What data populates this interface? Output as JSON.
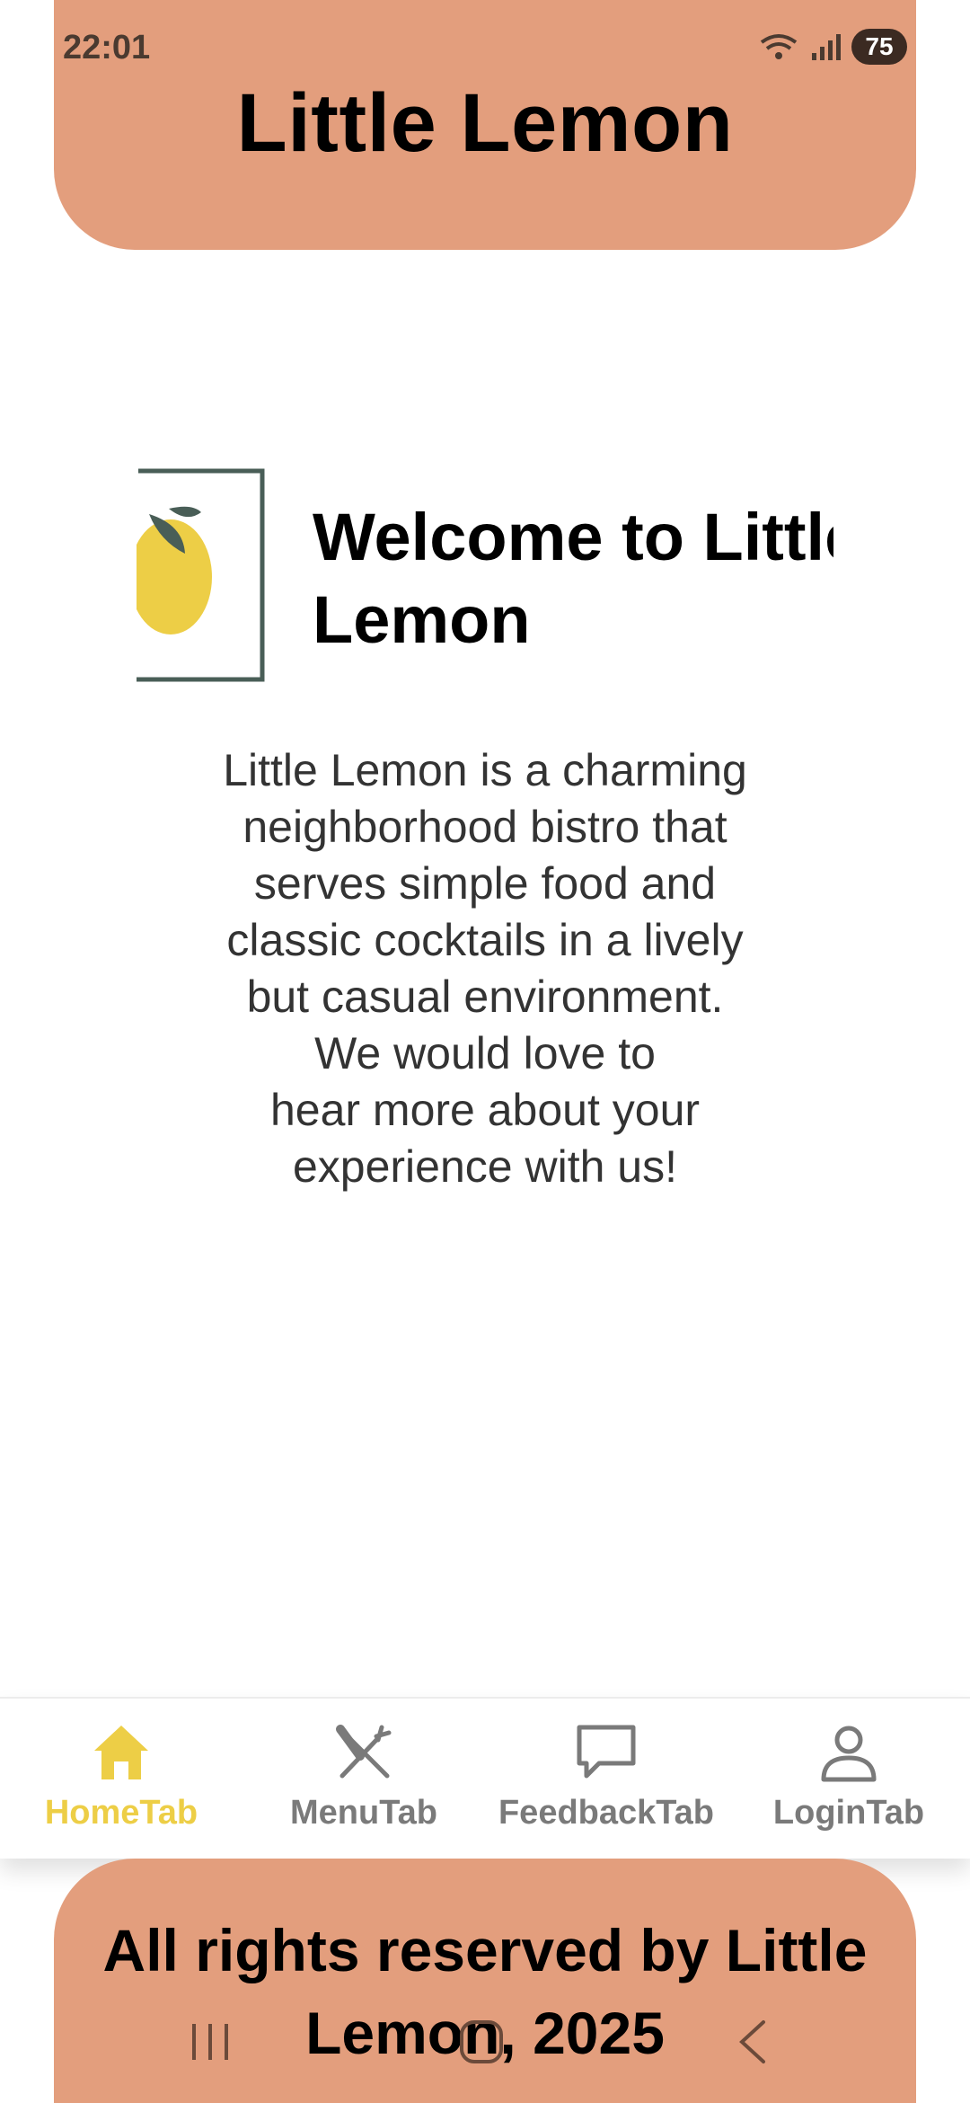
{
  "status_bar": {
    "time": "22:01",
    "battery": "75"
  },
  "header": {
    "title": "Little Lemon"
  },
  "welcome": {
    "title_lines": [
      "Welcome to Little",
      "Lemon"
    ],
    "description_lines": [
      "Little Lemon is a charming",
      "neighborhood bistro that",
      "serves simple food and",
      "classic cocktails in a lively",
      "but casual environment.",
      "We would love to",
      "hear more about your",
      "experience with us!"
    ]
  },
  "tabs": [
    {
      "label": "HomeTab",
      "icon": "home-icon",
      "active": true
    },
    {
      "label": "MenuTab",
      "icon": "cutlery-icon",
      "active": false
    },
    {
      "label": "FeedbackTab",
      "icon": "chat-icon",
      "active": false
    },
    {
      "label": "LoginTab",
      "icon": "person-icon",
      "active": false
    }
  ],
  "footer": {
    "lines": [
      "All rights reserved by Little",
      "Lemon, 2025"
    ]
  },
  "colors": {
    "brand": "#E39E7D",
    "lemon": "#EDCE46",
    "leaf": "#495E57",
    "inactive": "#7a7a7a"
  }
}
